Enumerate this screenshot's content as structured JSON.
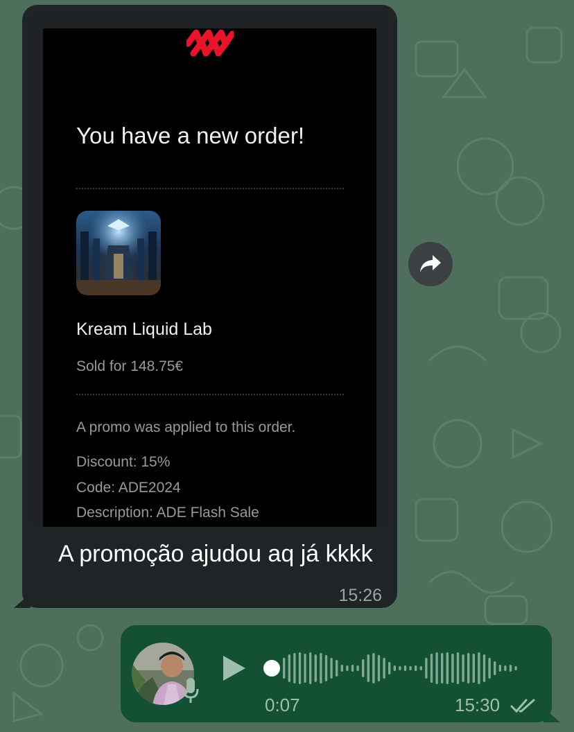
{
  "incoming_message": {
    "email": {
      "heading": "You have a new order!",
      "product_name": "Kream Liquid Lab",
      "sold_for": "Sold for 148.75€",
      "promo_note": "A promo was applied to this order.",
      "discount": "Discount: 15%",
      "code": "Code: ADE2024",
      "description": "Description: ADE Flash Sale"
    },
    "caption": "A promoção ajudou aq já kkkk",
    "time": "15:26"
  },
  "forward_button": {
    "icon": "forward-arrow-icon"
  },
  "outgoing_voice_message": {
    "duration": "0:07",
    "time": "15:30",
    "status": "read",
    "icons": [
      "play-icon",
      "microphone-icon",
      "double-check-icon"
    ]
  },
  "colors": {
    "wallpaper": "#4f6f5d",
    "incoming_bubble": "#1f2427",
    "outgoing_bubble": "#145033",
    "logo_red": "#e8152a"
  }
}
